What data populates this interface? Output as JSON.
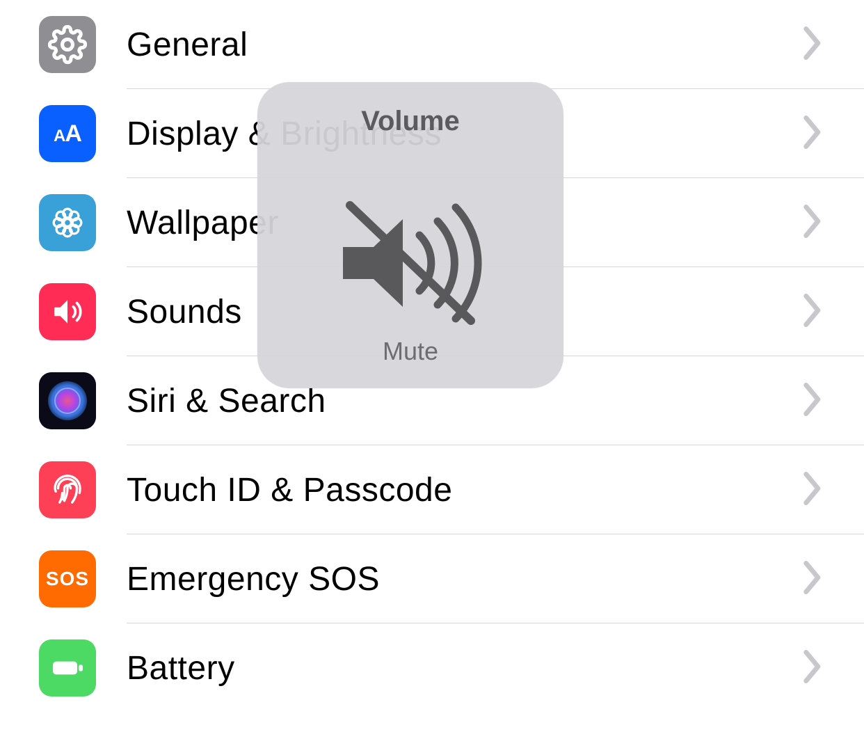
{
  "settings": {
    "items": [
      {
        "key": "general",
        "label": "General",
        "icon": "gear-icon",
        "bg": "bg-general"
      },
      {
        "key": "display",
        "label": "Display & Brightness",
        "icon": "text-size-icon",
        "bg": "bg-display"
      },
      {
        "key": "wallpaper",
        "label": "Wallpaper",
        "icon": "flower-icon",
        "bg": "bg-wallpaper"
      },
      {
        "key": "sounds",
        "label": "Sounds",
        "icon": "speaker-icon",
        "bg": "bg-sounds"
      },
      {
        "key": "siri",
        "label": "Siri & Search",
        "icon": "siri-icon",
        "bg": "bg-siri"
      },
      {
        "key": "touchid",
        "label": "Touch ID & Passcode",
        "icon": "fingerprint-icon",
        "bg": "bg-touchid"
      },
      {
        "key": "sos",
        "label": "Emergency SOS",
        "icon": "sos-icon",
        "bg": "bg-sos"
      },
      {
        "key": "battery",
        "label": "Battery",
        "icon": "battery-icon",
        "bg": "bg-battery"
      }
    ]
  },
  "overlay": {
    "title": "Volume",
    "subtitle": "Mute"
  }
}
